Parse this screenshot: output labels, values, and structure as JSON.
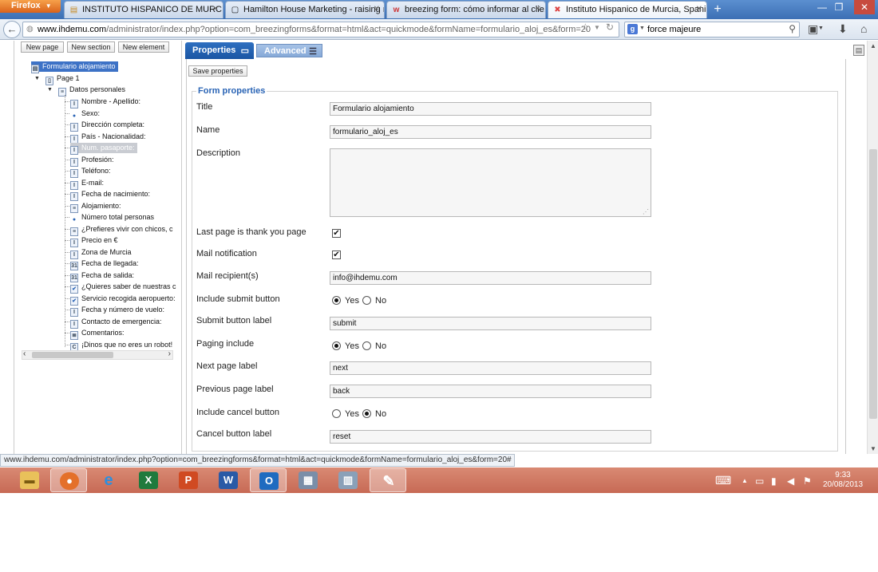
{
  "browser": {
    "menu_label": "Firefox",
    "tabs": [
      {
        "label": "INSTITUTO HISPANICO DE MURCIA",
        "icon": "folder-icon",
        "active": false
      },
      {
        "label": "Hamilton House Marketing - raising r...",
        "icon": "page-icon",
        "active": false
      },
      {
        "label": "breezing form: cómo informar al clie...",
        "icon": "w-icon",
        "active": false
      },
      {
        "label": "Instituto Hispanico de Murcia, Spanis...",
        "icon": "joomla-icon",
        "active": true
      }
    ],
    "url_host": "www.ihdemu.com",
    "url_path": "/administrator/index.php?option=com_breezingforms&format=html&act=quickmode&formName=formulario_aloj_es&form=20",
    "search_value": "force majeure",
    "status_text": "www.ihdemu.com/administrator/index.php?option=com_breezingforms&format=html&act=quickmode&formName=formulario_aloj_es&form=20#"
  },
  "toolbar": {
    "new_page": "New page",
    "new_section": "New section",
    "new_element": "New element"
  },
  "tree": {
    "root": "Formulario alojamiento",
    "page": "Page 1",
    "section": "Datos personales",
    "items": [
      {
        "label": "Nombre - Apellido:",
        "icon": "text-field-icon"
      },
      {
        "label": "Sexo:",
        "icon": "radio-icon"
      },
      {
        "label": "Dirección completa:",
        "icon": "text-field-icon"
      },
      {
        "label": "País - Nacionalidad:",
        "icon": "text-field-icon"
      },
      {
        "label": "Num. pasaporte:",
        "icon": "text-field-icon"
      },
      {
        "label": "Profesión:",
        "icon": "text-field-icon"
      },
      {
        "label": "Teléfono:",
        "icon": "text-field-icon"
      },
      {
        "label": "E-mail:",
        "icon": "text-field-icon"
      },
      {
        "label": "Fecha de nacimiento:",
        "icon": "text-field-icon"
      },
      {
        "label": "Alojamiento:",
        "icon": "select-icon"
      },
      {
        "label": "Número total personas",
        "icon": "radio-icon"
      },
      {
        "label": "¿Prefieres vivir con chicos, c",
        "icon": "select-icon"
      },
      {
        "label": "Precio en €",
        "icon": "text-field-icon"
      },
      {
        "label": "Zona de Murcia",
        "icon": "text-field-icon"
      },
      {
        "label": "Fecha de llegada:",
        "icon": "calendar-icon"
      },
      {
        "label": "Fecha de salida:",
        "icon": "calendar-icon"
      },
      {
        "label": "¿Quieres saber de nuestras c",
        "icon": "checkbox-icon"
      },
      {
        "label": "Servicio recogida aeropuerto:",
        "icon": "checkbox-icon"
      },
      {
        "label": "Fecha y número de vuelo:",
        "icon": "text-field-icon"
      },
      {
        "label": "Contacto de emergencia:",
        "icon": "text-field-icon"
      },
      {
        "label": "Comentarios:",
        "icon": "textarea-icon"
      },
      {
        "label": "¡Dinos que no eres un robot!",
        "icon": "captcha-icon"
      }
    ]
  },
  "tabs": {
    "properties": "Properties",
    "advanced": "Advanced"
  },
  "form": {
    "save_label": "Save properties",
    "legend": "Form properties",
    "title_label": "Title",
    "title_value": "Formulario alojamiento",
    "name_label": "Name",
    "name_value": "formulario_aloj_es",
    "description_label": "Description",
    "description_value": "",
    "last_page_label": "Last page is thank you page",
    "mail_notification_label": "Mail notification",
    "mail_recipient_label": "Mail recipient(s)",
    "mail_recipient_value": "info@ihdemu.com",
    "include_submit_label": "Include submit button",
    "submit_label_label": "Submit button label",
    "submit_label_value": "submit",
    "paging_include_label": "Paging include",
    "next_page_label": "Next page label",
    "next_page_value": "next",
    "previous_page_label": "Previous page label",
    "previous_page_value": "back",
    "include_cancel_label": "Include cancel button",
    "cancel_label_label": "Cancel button label",
    "cancel_label_value": "reset",
    "yes": "Yes",
    "no": "No"
  },
  "clock": {
    "time": "9:33",
    "date": "20/08/2013"
  }
}
